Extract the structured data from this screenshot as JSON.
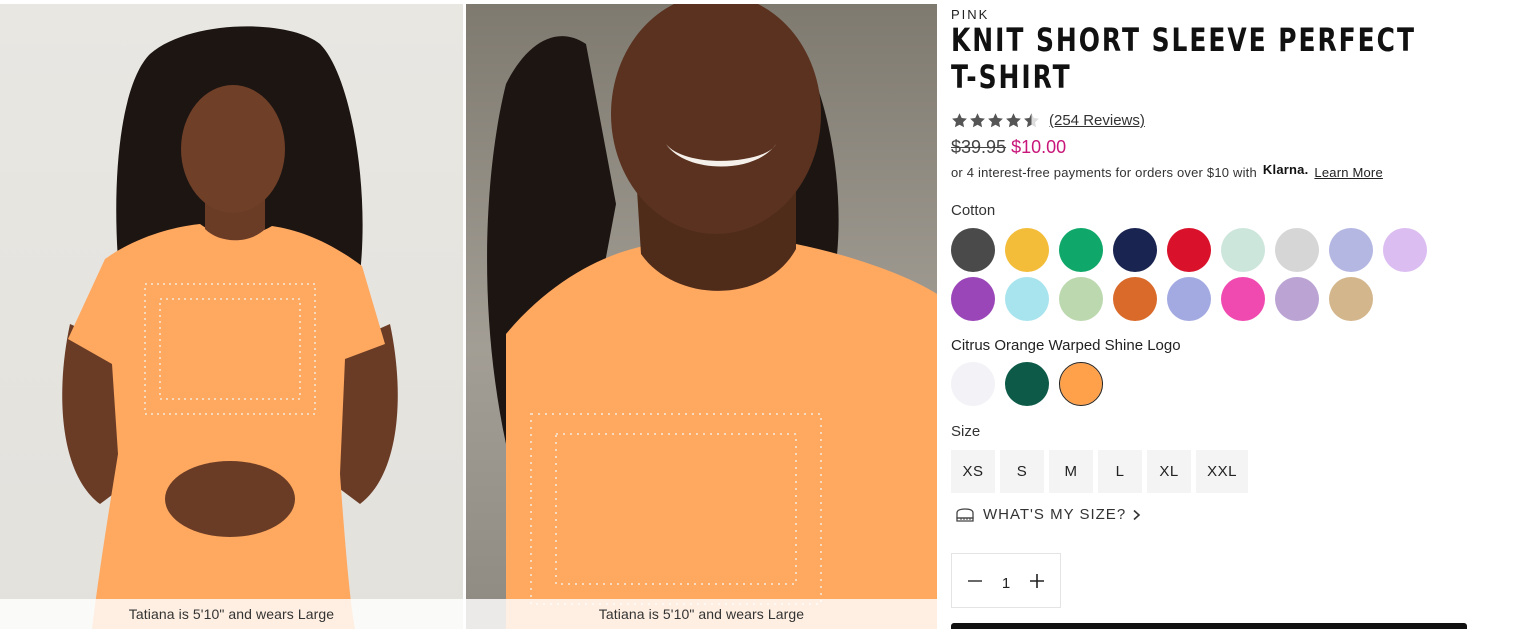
{
  "gallery": {
    "photos": [
      {
        "caption": "Tatiana is 5'10\" and wears Large"
      },
      {
        "caption": "Tatiana is 5'10\" and wears Large"
      }
    ]
  },
  "product": {
    "brand": "PINK",
    "title": "KNIT SHORT SLEEVE PERFECT T-SHIRT",
    "rating": {
      "value": 4.5,
      "out_of": 5,
      "reviews_label": "(254 Reviews)"
    },
    "price": {
      "original": "$39.95",
      "sale": "$10.00"
    },
    "klarna": {
      "text": "or 4 interest-free payments for orders over $10 with",
      "logo": "Klarna.",
      "link": "Learn More"
    },
    "cotton": {
      "label": "Cotton",
      "swatches": [
        "#4a4a4a",
        "#f3bd3a",
        "#10a86a",
        "#1a2450",
        "#d9112b",
        "#cde6dc",
        "#d6d6d6",
        "#b5b7e3",
        "#dcbdf1",
        "#9a45b8",
        "#a8e4ee",
        "#bcd8ae",
        "#d96a2a",
        "#a3aae2",
        "#f04ab0",
        "#bba3d4",
        "#d4b68c"
      ]
    },
    "variant": {
      "label": "Citrus Orange Warped Shine Logo",
      "swatches": [
        "#f2f2f7",
        "#0d5a48",
        "#ffa04a"
      ],
      "selected_index": 2
    },
    "size": {
      "label": "Size",
      "options": [
        "XS",
        "S",
        "M",
        "L",
        "XL",
        "XXL"
      ],
      "help": "WHAT'S MY SIZE?"
    },
    "quantity": "1"
  },
  "colors": {
    "sale": "#c8167a",
    "shirt": "#ffa860"
  },
  "icons": [
    "star-icon",
    "half-star-icon",
    "ruler-icon",
    "chevron-right-icon",
    "minus-icon",
    "plus-icon"
  ]
}
